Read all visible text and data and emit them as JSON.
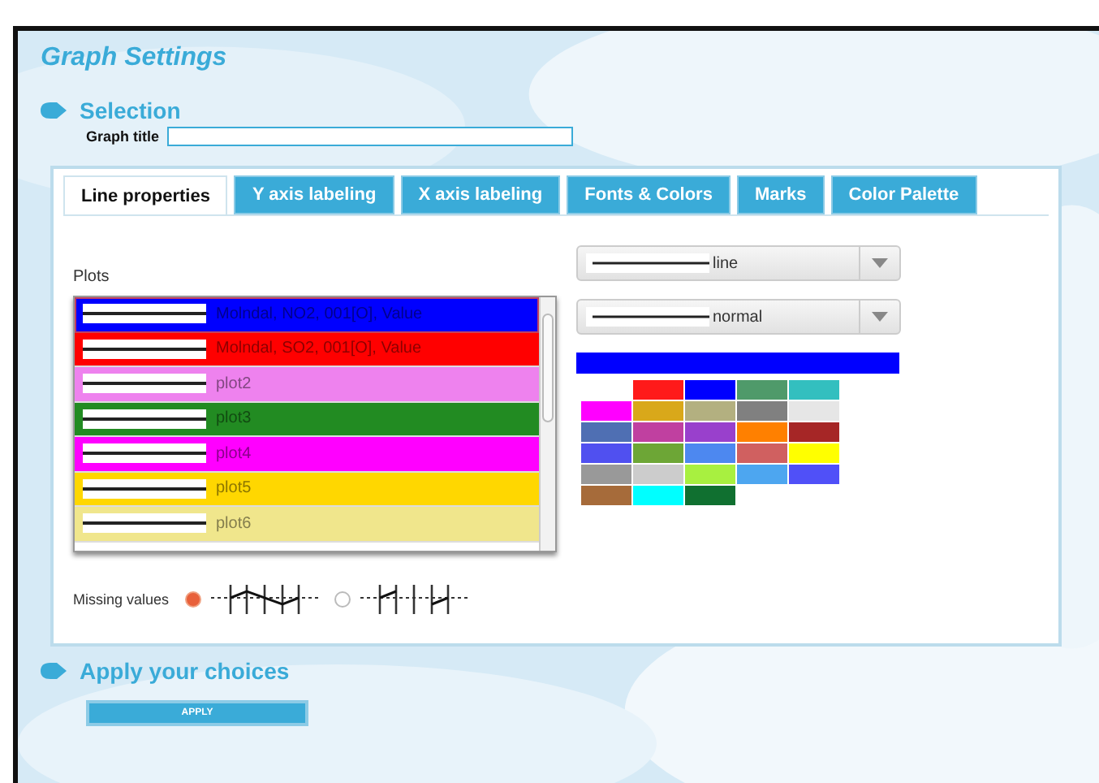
{
  "page_title": "Graph Settings",
  "selection": {
    "heading": "Selection",
    "graph_title_label": "Graph title"
  },
  "tabs": [
    {
      "label": "Line properties",
      "selected": true
    },
    {
      "label": "Y axis labeling",
      "selected": false
    },
    {
      "label": "X axis labeling",
      "selected": false
    },
    {
      "label": "Fonts & Colors",
      "selected": false
    },
    {
      "label": "Marks",
      "selected": false
    },
    {
      "label": "Color Palette",
      "selected": false
    }
  ],
  "plots": {
    "label": "Plots",
    "items": [
      {
        "label": "Molndal, NO2, 001[O], Value",
        "color": "#0000ff",
        "selected": true
      },
      {
        "label": "Molndal, SO2, 001[O], Value",
        "color": "#ff0000",
        "selected": false
      },
      {
        "label": "plot2",
        "color": "#ee82ee",
        "selected": false
      },
      {
        "label": "plot3",
        "color": "#228b22",
        "selected": false
      },
      {
        "label": "plot4",
        "color": "#ff00ff",
        "selected": false
      },
      {
        "label": "plot5",
        "color": "#ffd700",
        "selected": false
      },
      {
        "label": "plot6",
        "color": "#f0e68c",
        "selected": false
      }
    ]
  },
  "line_type": {
    "value": "line"
  },
  "line_width": {
    "value": "normal"
  },
  "current_color": {
    "color": "#0000ff"
  },
  "palette": [
    {
      "color": "#ff1a1a"
    },
    {
      "color": "#0000ff"
    },
    {
      "color": "#4f9a6a"
    },
    {
      "color": "#33bfbf"
    },
    {
      "color": "#ff00ff"
    },
    {
      "color": "#d9a81a"
    },
    {
      "color": "#b3b080"
    },
    {
      "color": "#808080"
    },
    {
      "color": "#e6e6e6"
    },
    {
      "color": "#4f6fb3"
    },
    {
      "color": "#c040a0"
    },
    {
      "color": "#9940cc"
    },
    {
      "color": "#ff8000"
    },
    {
      "color": "#a62626"
    },
    {
      "color": "#5050f0"
    },
    {
      "color": "#6da636"
    },
    {
      "color": "#4d88f0"
    },
    {
      "color": "#d06060"
    },
    {
      "color": "#ffff00"
    },
    {
      "color": "#999999"
    },
    {
      "color": "#cccccc"
    },
    {
      "color": "#a8f040"
    },
    {
      "color": "#4da6f0"
    },
    {
      "color": "#5050f8"
    },
    {
      "color": "#a66b3a"
    },
    {
      "color": "#00ffff"
    },
    {
      "color": "#107030"
    }
  ],
  "missing_values": {
    "label": "Missing values",
    "options": [
      {
        "kind": "connect",
        "selected": true
      },
      {
        "kind": "gap",
        "selected": false
      }
    ]
  },
  "apply": {
    "heading": "Apply your choices",
    "button": "APPLY"
  }
}
